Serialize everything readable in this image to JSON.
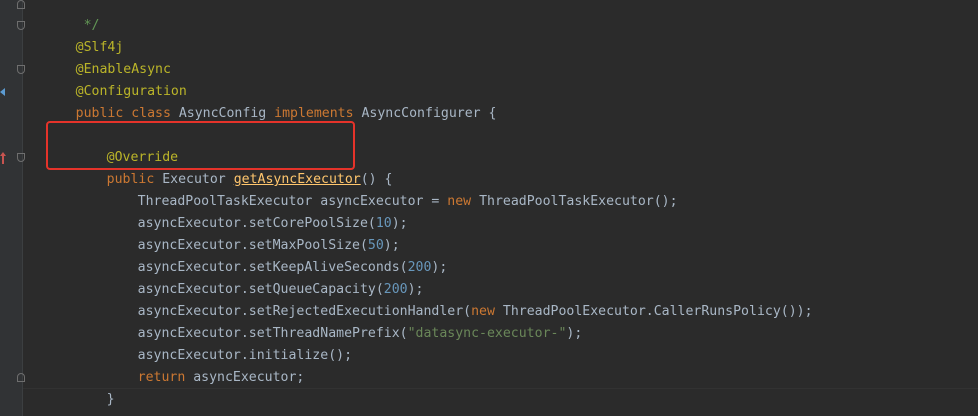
{
  "colors": {
    "background": "#2b2b2b",
    "keyword": "#cc7832",
    "annotation": "#bbb529",
    "method": "#ffc66d",
    "number": "#6897bb",
    "string": "#6a8759",
    "plain": "#a9b7c6",
    "highlight_border": "#e5332a"
  },
  "code": {
    "l0": {
      "c": " */"
    },
    "l1": {
      "ann": "@Slf4j"
    },
    "l2": {
      "ann": "@EnableAsync"
    },
    "l3": {
      "ann": "@Configuration"
    },
    "l4": {
      "kw1": "public class ",
      "name": "AsyncConfig ",
      "kw2": "implements ",
      "rest": "AsyncConfigurer {"
    },
    "l5": {
      "ann": "@Override"
    },
    "l6": {
      "kw": "public ",
      "type": "Executor ",
      "fn": "getAsyncExecutor",
      "rest": "() {"
    },
    "l7": {
      "a": "ThreadPoolTaskExecutor asyncExecutor = ",
      "kw": "new ",
      "b": "ThreadPoolTaskExecutor();"
    },
    "l8": {
      "a": "asyncExecutor.setCorePoolSize(",
      "num": "10",
      "b": ");"
    },
    "l9": {
      "a": "asyncExecutor.setMaxPoolSize(",
      "num": "50",
      "b": ");"
    },
    "l10": {
      "a": "asyncExecutor.setKeepAliveSeconds(",
      "num": "200",
      "b": ");"
    },
    "l11": {
      "a": "asyncExecutor.setQueueCapacity(",
      "num": "200",
      "b": ");"
    },
    "l12": {
      "a": "asyncExecutor.setRejectedExecutionHandler(",
      "kw": "new ",
      "b": "ThreadPoolExecutor.CallerRunsPolicy());"
    },
    "l13": {
      "a": "asyncExecutor.setThreadNamePrefix(",
      "str": "\"datasync-executor-\"",
      "b": ");"
    },
    "l14": {
      "a": "asyncExecutor.initialize();"
    },
    "l15": {
      "kw": "return ",
      "b": "asyncExecutor;"
    },
    "l16": {
      "a": "}"
    }
  }
}
